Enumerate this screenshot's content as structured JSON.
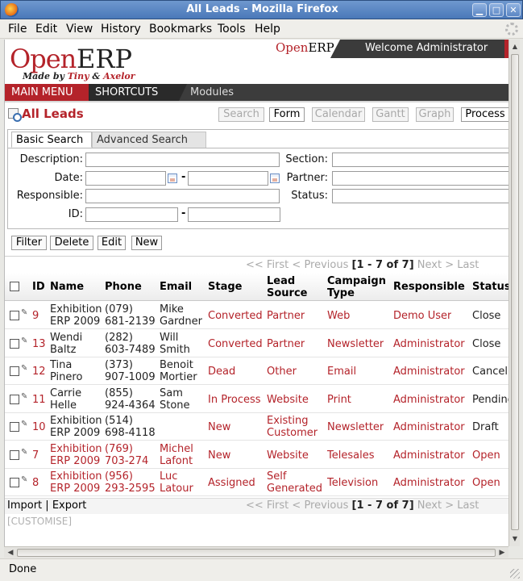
{
  "window": {
    "title": "All Leads - Mozilla Firefox"
  },
  "menubar": [
    "File",
    "Edit",
    "View",
    "History",
    "Bookmarks",
    "Tools",
    "Help"
  ],
  "header": {
    "logo_open": "Open",
    "logo_erp": "ERP",
    "made_by": "Made by",
    "made_tiny": "Tiny",
    "made_amp": "&",
    "made_axelor": "Axelor",
    "welcome": "Welcome Administrator"
  },
  "nav": {
    "main_menu": "MAIN MENU",
    "shortcuts": "SHORTCUTS",
    "modules": "Modules"
  },
  "page": {
    "title": "All Leads"
  },
  "views": [
    "Search",
    "Form",
    "Calendar",
    "Gantt",
    "Graph",
    "Process"
  ],
  "search": {
    "tabs": {
      "basic": "Basic Search",
      "advanced": "Advanced Search"
    },
    "labels": {
      "description": "Description:",
      "date": "Date:",
      "responsible": "Responsible:",
      "id": "ID:",
      "section": "Section:",
      "partner": "Partner:",
      "status": "Status:"
    },
    "dash": "-"
  },
  "actions": [
    "Filter",
    "Delete",
    "Edit",
    "New"
  ],
  "pager": {
    "first": "<< First",
    "previous": "< Previous",
    "range": "[1 - 7 of 7]",
    "next": "Next >",
    "last": "Last"
  },
  "grid": {
    "columns": [
      "ID",
      "Name",
      "Phone",
      "Email",
      "Stage",
      "Lead Source",
      "Campaign Type",
      "Responsible",
      "Status"
    ],
    "col_lines": {
      "lead_source": [
        "Lead",
        "Source"
      ],
      "campaign_type": [
        "Campaign",
        "Type"
      ]
    },
    "rows": [
      {
        "id": "9",
        "name": [
          "Exhibition",
          "ERP 2009"
        ],
        "phone": [
          "(079)",
          "681-2139"
        ],
        "email": [
          "Mike",
          "Gardner"
        ],
        "stage": "Converted",
        "source": [
          "Partner"
        ],
        "campaign": "Web",
        "responsible": "Demo User",
        "status": "Close",
        "highlight": false
      },
      {
        "id": "13",
        "name": [
          "Wendi",
          "Baltz"
        ],
        "phone": [
          "(282)",
          "603-7489"
        ],
        "email": [
          "Will",
          "Smith"
        ],
        "stage": "Converted",
        "source": [
          "Partner"
        ],
        "campaign": "Newsletter",
        "responsible": "Administrator",
        "status": "Close",
        "highlight": false
      },
      {
        "id": "12",
        "name": [
          "Tina",
          "Pinero"
        ],
        "phone": [
          "(373)",
          "907-1009"
        ],
        "email": [
          "Benoit",
          "Mortier"
        ],
        "stage": "Dead",
        "source": [
          "Other"
        ],
        "campaign": "Email",
        "responsible": "Administrator",
        "status": "Cancel",
        "highlight": false
      },
      {
        "id": "11",
        "name": [
          "Carrie",
          "Helle"
        ],
        "phone": [
          "(855)",
          "924-4364"
        ],
        "email": [
          "Sam",
          "Stone"
        ],
        "stage": "In Process",
        "source": [
          "Website"
        ],
        "campaign": "Print",
        "responsible": "Administrator",
        "status": "Pending",
        "highlight": false
      },
      {
        "id": "10",
        "name": [
          "Exhibition",
          "ERP 2009"
        ],
        "phone": [
          "(514)",
          "698-4118"
        ],
        "email": [
          "",
          ""
        ],
        "stage": "New",
        "source": [
          "Existing",
          "Customer"
        ],
        "campaign": "Newsletter",
        "responsible": "Administrator",
        "status": "Draft",
        "highlight": false
      },
      {
        "id": "7",
        "name": [
          "Exhibition",
          "ERP 2009"
        ],
        "phone": [
          "(769)",
          "703-274"
        ],
        "email": [
          "Michel",
          "Lafont"
        ],
        "stage": "New",
        "source": [
          "Website"
        ],
        "campaign": "Telesales",
        "responsible": "Administrator",
        "status": "Open",
        "highlight": true
      },
      {
        "id": "8",
        "name": [
          "Exhibition",
          "ERP 2009"
        ],
        "phone": [
          "(956)",
          "293-2595"
        ],
        "email": [
          "Luc",
          "Latour"
        ],
        "stage": "Assigned",
        "source": [
          "Self",
          "Generated"
        ],
        "campaign": "Television",
        "responsible": "Administrator",
        "status": "Open",
        "highlight": true
      }
    ]
  },
  "footer": {
    "import": "Import",
    "sep": "|",
    "export": "Export",
    "customise": "[CUSTOMISE]"
  },
  "statusbar": {
    "text": "Done"
  },
  "colors": {
    "accent": "#b4232a",
    "nav": "#3c3c3c",
    "title_bar": "#4a78b8"
  }
}
